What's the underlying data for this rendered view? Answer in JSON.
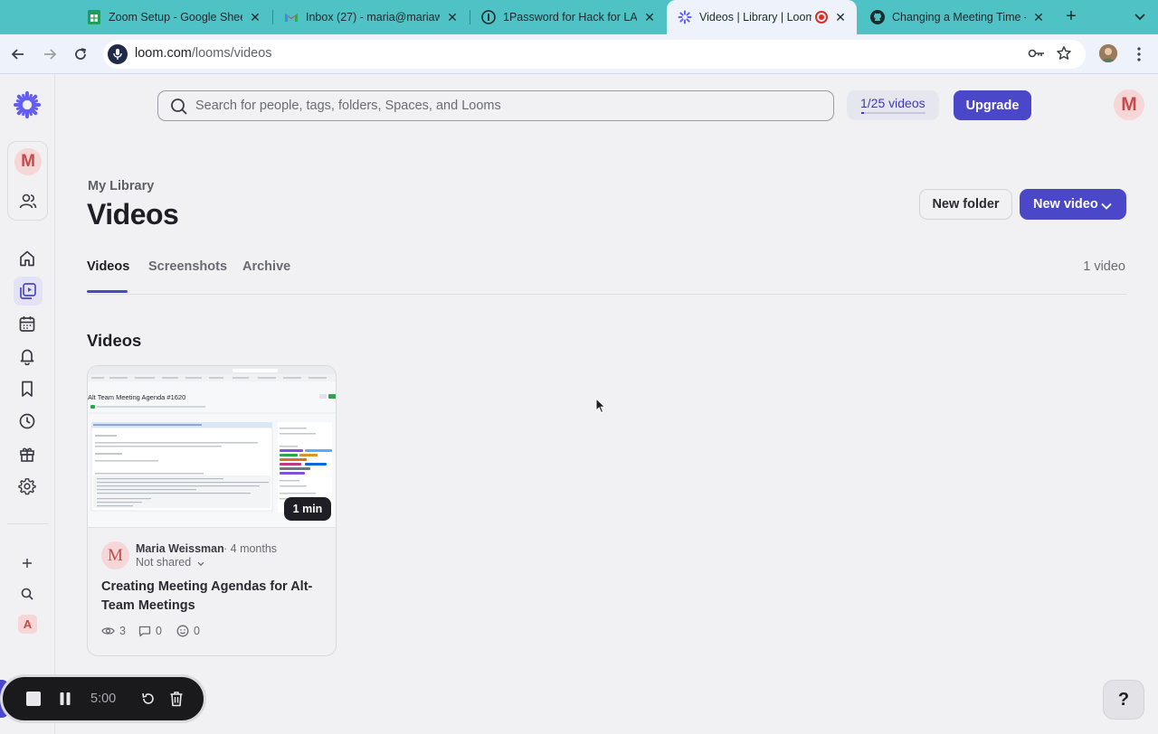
{
  "browser": {
    "tabs": [
      {
        "title": "Zoom Setup - Google Shee",
        "icon": "google-sheets-icon"
      },
      {
        "title": "Inbox (27) - maria@mariaw",
        "icon": "gmail-icon"
      },
      {
        "title": "1Password for Hack for LA",
        "icon": "1password-icon"
      },
      {
        "title": "Videos | Library | Loom",
        "icon": "loom-icon",
        "active": true
      },
      {
        "title": "Changing a Meeting Time - I",
        "icon": "github-icon"
      }
    ],
    "url_domain": "loom.com",
    "url_path": "/looms/videos"
  },
  "header": {
    "search_placeholder": "Search for people, tags, folders, Spaces, and Looms",
    "quota_label": "1/25 videos",
    "quota_used": 1,
    "quota_total": 25,
    "upgrade_label": "Upgrade",
    "avatar_initial": "M"
  },
  "rail": {
    "workspace_initial": "M",
    "bottom_initial": "A"
  },
  "page": {
    "breadcrumb": "My Library",
    "title": "Videos",
    "new_folder_label": "New folder",
    "new_video_label": "New video",
    "tabs": [
      "Videos",
      "Screenshots",
      "Archive"
    ],
    "active_tab": "Videos",
    "count_label": "1 video",
    "section_title": "Videos"
  },
  "videos": [
    {
      "author": "Maria Weissman",
      "age": "4 months",
      "share": "Not shared",
      "title": "Creating Meeting Agendas for Alt-Team Meetings",
      "duration": "1 min",
      "views": "3",
      "comments": "0",
      "reactions": "0",
      "author_initial": "M",
      "thumb_heading": "Alt Team Meeting Agenda #1620"
    }
  ],
  "recorder": {
    "time": "5:00"
  },
  "help_label": "?",
  "colors": {
    "accent": "#4b47c9",
    "tab_strip": "#4fc2c6",
    "avatar_bg": "#f6d6d6",
    "avatar_fg": "#c74a4a"
  }
}
